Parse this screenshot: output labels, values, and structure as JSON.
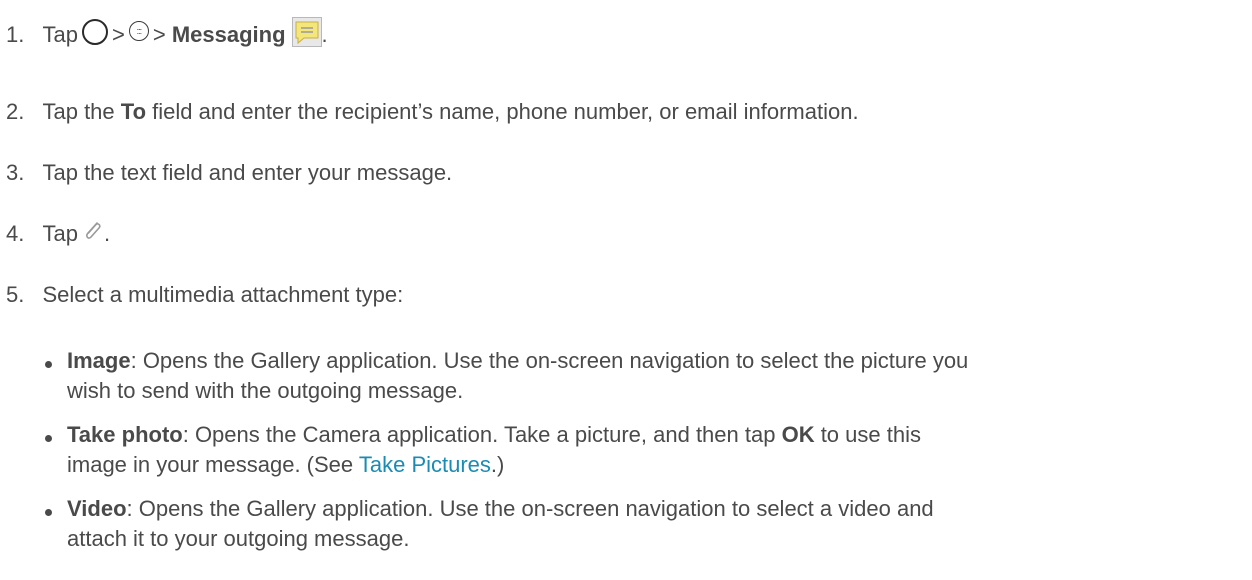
{
  "steps": [
    {
      "num": "1.",
      "tap": "Tap",
      "sep1": ">",
      "sep2": ">",
      "app": "Messaging",
      "end": "."
    },
    {
      "num": "2.",
      "pre": "Tap the ",
      "bold": "To",
      "post": " field and enter the recipient’s name, phone number, or email information."
    },
    {
      "num": "3.",
      "text": "Tap the text field and enter your message."
    },
    {
      "num": "4.",
      "tap": "Tap",
      "end": "."
    },
    {
      "num": "5.",
      "text": "Select a multimedia attachment type:"
    }
  ],
  "bullets": [
    {
      "term": "Image",
      "line1": ": Opens the Gallery application. Use the on-screen navigation to select the picture you",
      "line2": "wish to send with the outgoing message."
    },
    {
      "term": "Take photo",
      "line1a": ": Opens the Camera application. Take a picture, and then tap ",
      "ok": "OK",
      "line1b": " to use this",
      "line2a": "image in your message. (See ",
      "link": "Take Pictures",
      "line2b": ".)"
    },
    {
      "term": "Video",
      "line1": ": Opens the Gallery application. Use the on-screen navigation to select a video and",
      "line2": "attach it to your outgoing message."
    }
  ],
  "icons": {
    "home": "home-circle-icon",
    "apps": "apps-grid-icon",
    "messaging": "messaging-app-icon",
    "attach": "paperclip-icon"
  },
  "colors": {
    "text": "#4a4a4a",
    "link": "#1a8bb3",
    "messaging_icon": "#f5e67a"
  }
}
